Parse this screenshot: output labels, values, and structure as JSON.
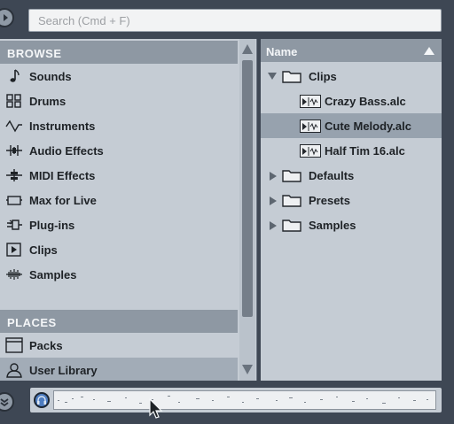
{
  "search": {
    "placeholder": "Search (Cmd + F)"
  },
  "browse": {
    "header": "BROWSE",
    "items": [
      {
        "label": "Sounds",
        "icon": "note-icon"
      },
      {
        "label": "Drums",
        "icon": "drum-grid-icon"
      },
      {
        "label": "Instruments",
        "icon": "waveform-icon"
      },
      {
        "label": "Audio Effects",
        "icon": "audio-effects-icon"
      },
      {
        "label": "MIDI Effects",
        "icon": "midi-effects-icon"
      },
      {
        "label": "Max for Live",
        "icon": "max-for-live-icon"
      },
      {
        "label": "Plug-ins",
        "icon": "plugin-icon"
      },
      {
        "label": "Clips",
        "icon": "clip-icon"
      },
      {
        "label": "Samples",
        "icon": "samples-icon"
      }
    ]
  },
  "places": {
    "header": "PLACES",
    "items": [
      {
        "label": "Packs",
        "icon": "packs-icon"
      },
      {
        "label": "User Library",
        "icon": "user-icon",
        "selected": true
      }
    ]
  },
  "filelist": {
    "column_header": "Name",
    "items": [
      {
        "label": "Clips",
        "type": "folder",
        "expanded": true
      },
      {
        "label": "Crazy Bass.alc",
        "type": "clip"
      },
      {
        "label": "Cute Melody.alc",
        "type": "clip",
        "selected": true
      },
      {
        "label": "Half Tim 16.alc",
        "type": "clip"
      },
      {
        "label": "Defaults",
        "type": "folder",
        "expanded": false
      },
      {
        "label": "Presets",
        "type": "folder",
        "expanded": false
      },
      {
        "label": "Samples",
        "type": "folder",
        "expanded": false
      }
    ]
  },
  "colors": {
    "panel_bg": "#c5ccd4",
    "header_bg": "#8e98a3",
    "selected_row": "#97a2ae",
    "chrome_bg": "#3e4754",
    "preview_accent": "#4e7dc0"
  }
}
